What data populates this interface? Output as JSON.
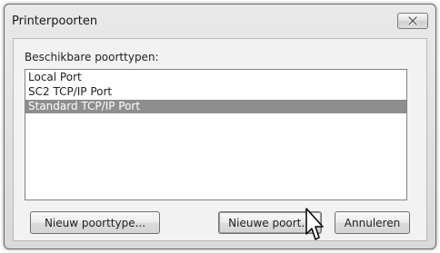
{
  "window": {
    "title": "Printerpoorten"
  },
  "port_types": {
    "label": "Beschikbare poorttypen:",
    "items": [
      {
        "label": "Local Port",
        "selected": false
      },
      {
        "label": "SC2 TCP/IP Port",
        "selected": false
      },
      {
        "label": "Standard TCP/IP Port",
        "selected": true
      }
    ]
  },
  "buttons": {
    "new_port_type": "Nieuw poorttype...",
    "new_port": "Nieuwe poort...",
    "cancel": "Annuleren"
  },
  "icons": {
    "close": "close-icon",
    "cursor": "mouse-pointer-icon"
  },
  "colors": {
    "selection": "#8e8e8e",
    "dialog_background": "#f2f2f2"
  }
}
